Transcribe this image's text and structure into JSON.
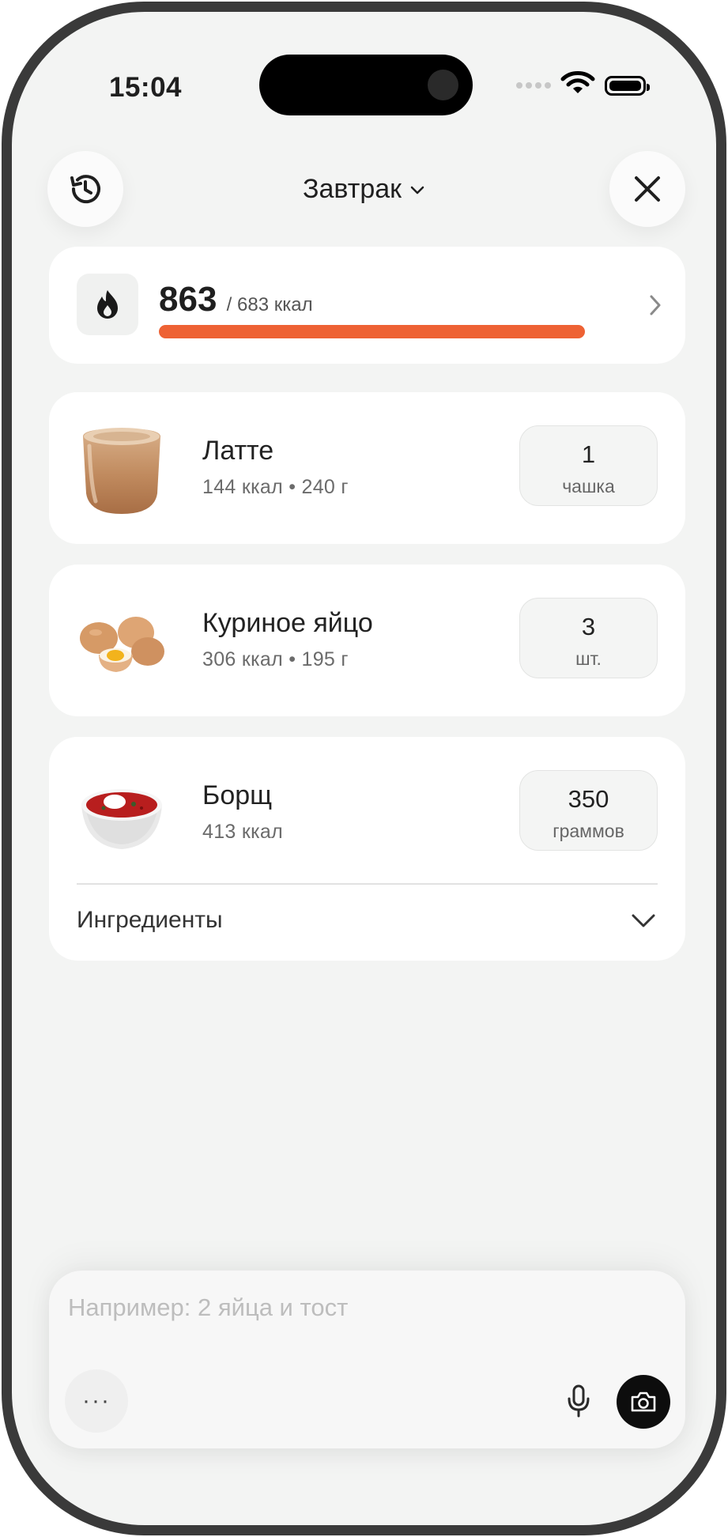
{
  "status_bar": {
    "time": "15:04"
  },
  "header": {
    "title": "Завтрак"
  },
  "calories": {
    "current": "863",
    "goal_text": "/ 683 ккал",
    "progress_fraction": 1.0,
    "accent_color": "#ee6234"
  },
  "foods": [
    {
      "name": "Латте",
      "meta": "144 ккал • 240 г",
      "quantity": "1",
      "unit": "чашка"
    },
    {
      "name": "Куриное яйцо",
      "meta": "306 ккал • 195 г",
      "quantity": "3",
      "unit": "шт."
    },
    {
      "name": "Борщ",
      "meta": "413 ккал",
      "quantity": "350",
      "unit": "граммов",
      "expand_label": "Ингредиенты"
    }
  ],
  "composer": {
    "placeholder": "Например: 2 яйца и тост",
    "more_label": "···"
  }
}
